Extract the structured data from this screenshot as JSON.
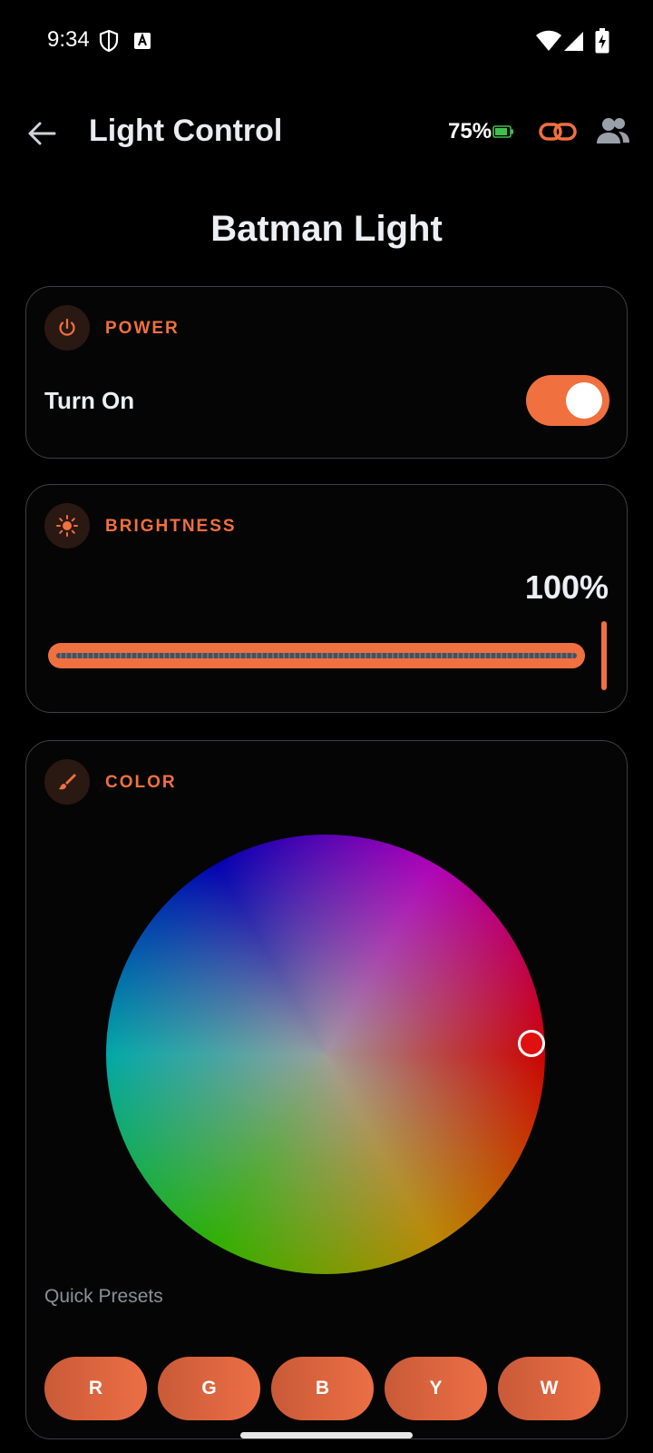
{
  "status_bar": {
    "time": "9:34"
  },
  "app_bar": {
    "title": "Light Control",
    "battery_percent": "75%"
  },
  "device": {
    "name": "Batman Light"
  },
  "power": {
    "section_label": "POWER",
    "toggle_label": "Turn On",
    "state": true
  },
  "brightness": {
    "section_label": "BRIGHTNESS",
    "value_text": "100%",
    "level_fraction": 1.0
  },
  "color": {
    "section_label": "COLOR",
    "selected_color": "#E01010",
    "presets_label": "Quick Presets",
    "presets": [
      "R",
      "G",
      "B",
      "Y",
      "W"
    ]
  },
  "colors": {
    "accent": "#F0703F",
    "background": "#000000",
    "card_border": "#3C3F45"
  },
  "icons": {
    "back": "arrow-back-icon",
    "battery": "battery-icon",
    "link": "link-icon",
    "people": "people-icon",
    "power": "power-icon",
    "brightness": "sun-icon",
    "color": "brush-icon"
  }
}
